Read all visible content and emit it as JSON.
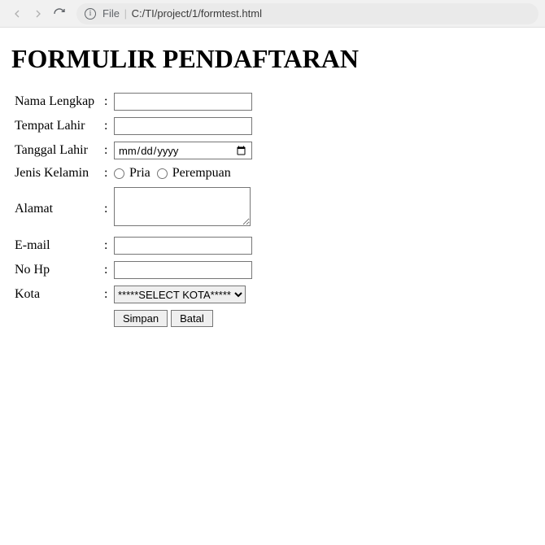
{
  "browser": {
    "prefix": "File",
    "path": "C:/TI/project/1/formtest.html"
  },
  "page": {
    "title": "FORMULIR PENDAFTARAN"
  },
  "form": {
    "nama_label": "Nama Lengkap",
    "tempat_label": "Tempat Lahir",
    "tanggal_label": "Tanggal Lahir",
    "date_placeholder": "mm/dd/yyyy",
    "jenis_label": "Jenis Kelamin",
    "radio_pria": "Pria",
    "radio_perempuan": "Perempuan",
    "alamat_label": "Alamat",
    "email_label": "E-mail",
    "nohp_label": "No Hp",
    "kota_label": "Kota",
    "kota_placeholder_option": "*****SELECT KOTA*****",
    "btn_simpan": "Simpan",
    "btn_batal": "Batal",
    "colon": ":"
  }
}
